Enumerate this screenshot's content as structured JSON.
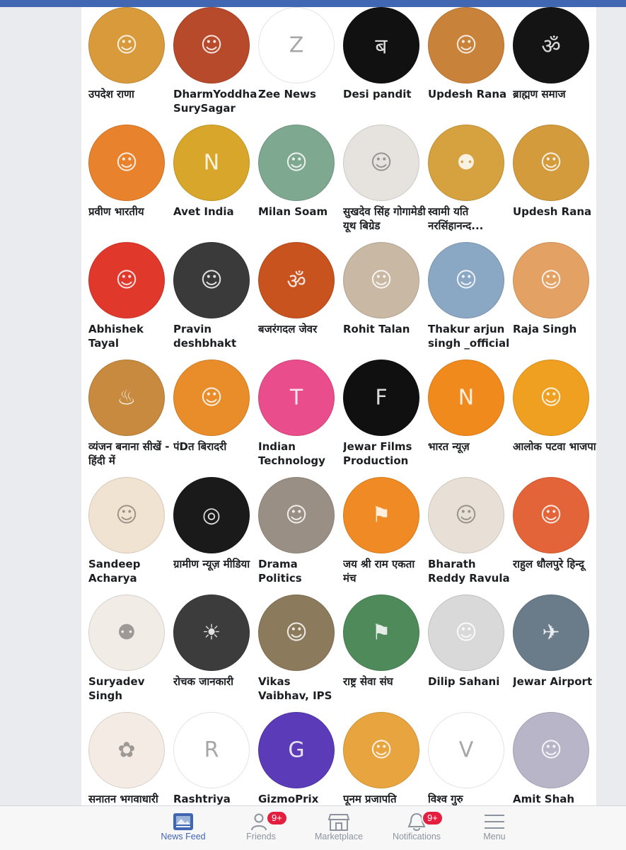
{
  "grid": {
    "items": [
      {
        "name": "उपदेश राणा",
        "bg": "#d89a3a",
        "icon": "person-icon"
      },
      {
        "name": "DharmYoddha SurySagar सू...",
        "bg": "#b84a2c",
        "icon": "person-icon"
      },
      {
        "name": "Zee News",
        "bg": "#ffffff",
        "icon": "zee-logo-icon"
      },
      {
        "name": "Desi pandit",
        "bg": "#111111",
        "icon": "brahman-logo-icon"
      },
      {
        "name": "Updesh Rana",
        "bg": "#c9823a",
        "icon": "person-icon"
      },
      {
        "name": "ब्राह्मण समाज",
        "bg": "#141414",
        "icon": "pandit-logo-icon"
      },
      {
        "name": "प्रवीण भारतीय",
        "bg": "#e8822c",
        "icon": "person-icon"
      },
      {
        "name": "Avet India",
        "bg": "#d8a62a",
        "icon": "news-logo-icon"
      },
      {
        "name": "Milan Soam",
        "bg": "#7fa890",
        "icon": "person-icon"
      },
      {
        "name": "सुखदेव सिंह गोगामेडी यूथ बिग्रेड",
        "bg": "#e6e3df",
        "icon": "person-icon"
      },
      {
        "name": "स्वामी यति नरसिंहानन्द...",
        "bg": "#d6a23f",
        "icon": "group-icon"
      },
      {
        "name": "Updesh Rana",
        "bg": "#d49b3d",
        "icon": "person-icon"
      },
      {
        "name": "Abhishek Tayal",
        "bg": "#e0392c",
        "icon": "person-icon"
      },
      {
        "name": "Pravin deshbhakt",
        "bg": "#3a3a3a",
        "icon": "person-icon"
      },
      {
        "name": "बजरंगदल जेवर",
        "bg": "#c8531f",
        "icon": "hanuman-icon"
      },
      {
        "name": "Rohit Talan",
        "bg": "#c9b8a4",
        "icon": "person-icon"
      },
      {
        "name": "Thakur arjun singh _official",
        "bg": "#8aa7c4",
        "icon": "person-icon"
      },
      {
        "name": "Raja Singh",
        "bg": "#e4a164",
        "icon": "person-icon"
      },
      {
        "name": "व्यंजन बनाना सीखें - हिंदी में",
        "bg": "#c88a3e",
        "icon": "food-icon"
      },
      {
        "name": "पंDत बिरादरी",
        "bg": "#e88d2a",
        "icon": "person-icon"
      },
      {
        "name": "Indian Technology",
        "bg": "#e94d8b",
        "icon": "tech-logo-icon"
      },
      {
        "name": "Jewar Films Production",
        "bg": "#101010",
        "icon": "film-logo-icon"
      },
      {
        "name": "भारत न्यूज़",
        "bg": "#f08a1d",
        "icon": "news-logo-icon"
      },
      {
        "name": "आलोक पटवा भाजपा",
        "bg": "#f0a020",
        "icon": "person-icon"
      },
      {
        "name": "Sandeep Acharya",
        "bg": "#f0e3d2",
        "icon": "person-icon"
      },
      {
        "name": "ग्रामीण न्यूज़ मीडिया",
        "bg": "#1a1a1a",
        "icon": "globe-icon"
      },
      {
        "name": "Drama Politics",
        "bg": "#9a8f84",
        "icon": "person-icon"
      },
      {
        "name": "जय श्री राम एकता मंच",
        "bg": "#f08a24",
        "icon": "flag-icon"
      },
      {
        "name": "Bharath Reddy Ravula",
        "bg": "#e8e0d6",
        "icon": "person-icon"
      },
      {
        "name": "राहुल धौलपुरे हिन्दू",
        "bg": "#e4643a",
        "icon": "person-icon"
      },
      {
        "name": "Suryadev Singh",
        "bg": "#f2ece6",
        "icon": "group-icon"
      },
      {
        "name": "रोचक जानकारी",
        "bg": "#3c3c3c",
        "icon": "bulb-icon"
      },
      {
        "name": "Vikas Vaibhav, IPS",
        "bg": "#8c7a5c",
        "icon": "person-icon"
      },
      {
        "name": "राष्ट्र सेवा संघ",
        "bg": "#4f8a5a",
        "icon": "flag-icon"
      },
      {
        "name": "Dilip Sahani",
        "bg": "#d9d9d9",
        "icon": "person-icon"
      },
      {
        "name": "Jewar Airport",
        "bg": "#6a7b8a",
        "icon": "plane-icon"
      },
      {
        "name": "सनातन भगवाधारी",
        "bg": "#f3ebe4",
        "icon": "bjp-logo-icon"
      },
      {
        "name": "Rashtriya",
        "bg": "#ffffff",
        "icon": "rcp-logo-icon"
      },
      {
        "name": "GizmoPrix",
        "bg": "#5b3bb8",
        "icon": "gizmo-logo-icon"
      },
      {
        "name": "पूनम प्रजापति",
        "bg": "#e8a43e",
        "icon": "person-icon"
      },
      {
        "name": "विश्व गुरु",
        "bg": "#ffffff",
        "icon": "vishwa-logo-icon"
      },
      {
        "name": "Amit Shah",
        "bg": "#b9b5c8",
        "icon": "person-icon"
      }
    ]
  },
  "tabbar": {
    "news_feed": "News Feed",
    "friends": "Friends",
    "friends_badge": "9+",
    "marketplace": "Marketplace",
    "notifications": "Notifications",
    "notifications_badge": "9+",
    "menu": "Menu"
  },
  "colors": {
    "accent": "#4267b2",
    "badge": "#e41e3f"
  }
}
